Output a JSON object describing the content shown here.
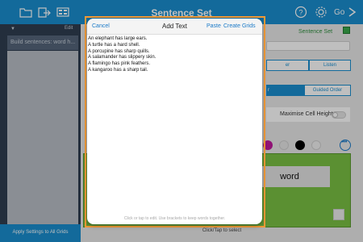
{
  "app": {
    "title": "Sentence Set",
    "go_label": "Go"
  },
  "topbar_icons": [
    "folder-icon",
    "export-icon",
    "grid-icon",
    "help-icon",
    "gear-icon",
    "arrow-right-icon"
  ],
  "sidebar": {
    "edit_label": "Edit",
    "selected_item": "Build sentences: word h...",
    "footer_label": "Apply Settings to All Grids"
  },
  "panel": {
    "set_label": "Sentence Set",
    "listen_label": "Listen",
    "listen_left_label": "er",
    "order_selected_label": "r",
    "guided_order_label": "Guided Order",
    "maximise_label": "Maximise Cell Height",
    "maximise_on": false,
    "swatches": [
      "#c0199c",
      "#e6e6e6",
      "#000000",
      "#f1f1f1"
    ],
    "word_cell": "word",
    "bottom_hint": "Click/Tap to select"
  },
  "modal": {
    "cancel_label": "Cancel",
    "title": "Add Text",
    "paste_label": "Paste",
    "create_label": "Create Grids",
    "lines": [
      "An elephant has large ears.",
      "A turtle has a hard shell.",
      "A porcupine has sharp quills.",
      "A salamander has slippery skin.",
      "A flamingo has pink feathers.",
      "A kangaroo has a sharp tail."
    ],
    "hint": "Click or tap to edit. Use brackets to keep words together."
  },
  "colors": {
    "brand_blue": "#1a8ecf",
    "sidebar_dark": "#2f3e50",
    "accent_orange": "#f29a36",
    "grid_green": "#7ac143"
  }
}
